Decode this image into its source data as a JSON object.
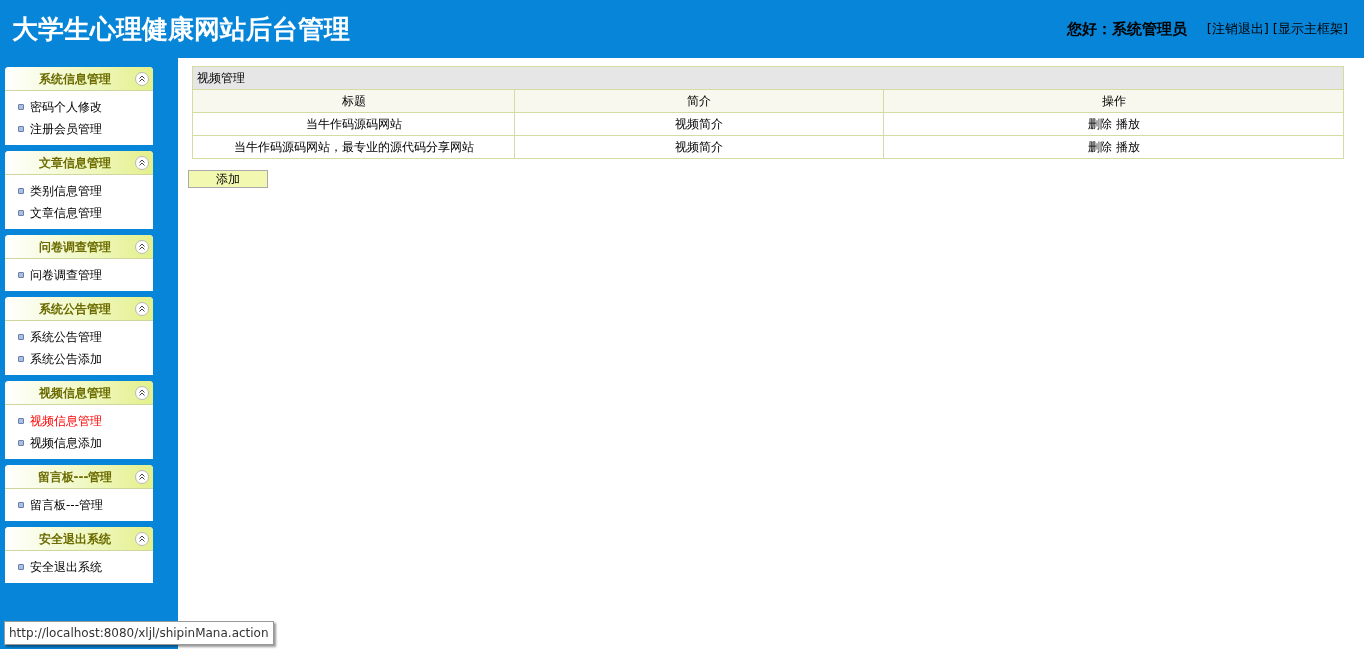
{
  "header": {
    "title": "大学生心理健康网站后台管理",
    "greeting": "您好：系统管理员",
    "links": [
      "[注销退出]",
      "[显示主框架]"
    ]
  },
  "sidebar": {
    "groups": [
      {
        "title": "系统信息管理",
        "items": [
          {
            "label": "密码个人修改",
            "selected": false
          },
          {
            "label": "注册会员管理",
            "selected": false
          }
        ]
      },
      {
        "title": "文章信息管理",
        "items": [
          {
            "label": "类别信息管理",
            "selected": false
          },
          {
            "label": "文章信息管理",
            "selected": false
          }
        ]
      },
      {
        "title": "问卷调查管理",
        "items": [
          {
            "label": "问卷调查管理",
            "selected": false
          }
        ]
      },
      {
        "title": "系统公告管理",
        "items": [
          {
            "label": "系统公告管理",
            "selected": false
          },
          {
            "label": "系统公告添加",
            "selected": false
          }
        ]
      },
      {
        "title": "视频信息管理",
        "items": [
          {
            "label": "视频信息管理",
            "selected": true
          },
          {
            "label": "视频信息添加",
            "selected": false
          }
        ]
      },
      {
        "title": "留言板---管理",
        "items": [
          {
            "label": "留言板---管理",
            "selected": false
          }
        ]
      },
      {
        "title": "安全退出系统",
        "items": [
          {
            "label": "安全退出系统",
            "selected": false
          }
        ]
      }
    ]
  },
  "table": {
    "caption": "视频管理",
    "columns": [
      "标题",
      "简介",
      "操作"
    ],
    "rows": [
      {
        "title": "当牛作码源码网站",
        "intro": "视频简介",
        "actions": [
          "删除",
          "播放"
        ]
      },
      {
        "title": "当牛作码源码网站，最专业的源代码分享网站",
        "intro": "视频简介",
        "actions": [
          "删除",
          "播放"
        ]
      }
    ]
  },
  "add_button": "添加",
  "status_bar": "http://localhost:8080/xljl/shipinMana.action"
}
